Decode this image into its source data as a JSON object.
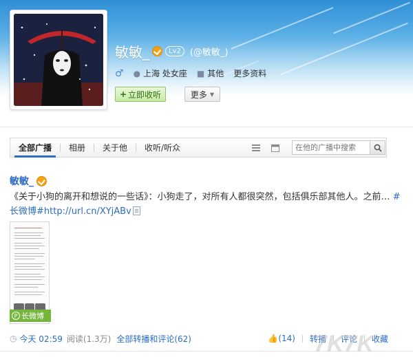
{
  "profile": {
    "name": "敏敏_",
    "level": "Lv2",
    "handle": "(@敏敏_)",
    "location": "上海 处女座",
    "other": "其他",
    "more_info": "更多资料",
    "follow_label": "立即收听",
    "more_label": "更多"
  },
  "tabs": {
    "items": [
      "全部广播",
      "相册",
      "关于他",
      "收听/听众"
    ],
    "search_placeholder": "在他的广播中搜索"
  },
  "post": {
    "author": "敏敏_",
    "text_main": "《关于小狗的离开和想说的一些话》：小狗走了，对所有人都很突然，包括俱乐部其他人。之前… ",
    "tag": "#长微博",
    "link": "#http://url.cn/XYjABv",
    "long_badge": "长微博",
    "time": "今天 02:59",
    "read": "阅读(1.3万)",
    "comments_all": "全部转播和评论(62)",
    "likes": "(14)",
    "actions": [
      "转播",
      "评论",
      "收藏"
    ]
  },
  "colors": {
    "link": "#2b6cc4",
    "follow_green": "#75b53c",
    "vip": "#f4a21a"
  }
}
